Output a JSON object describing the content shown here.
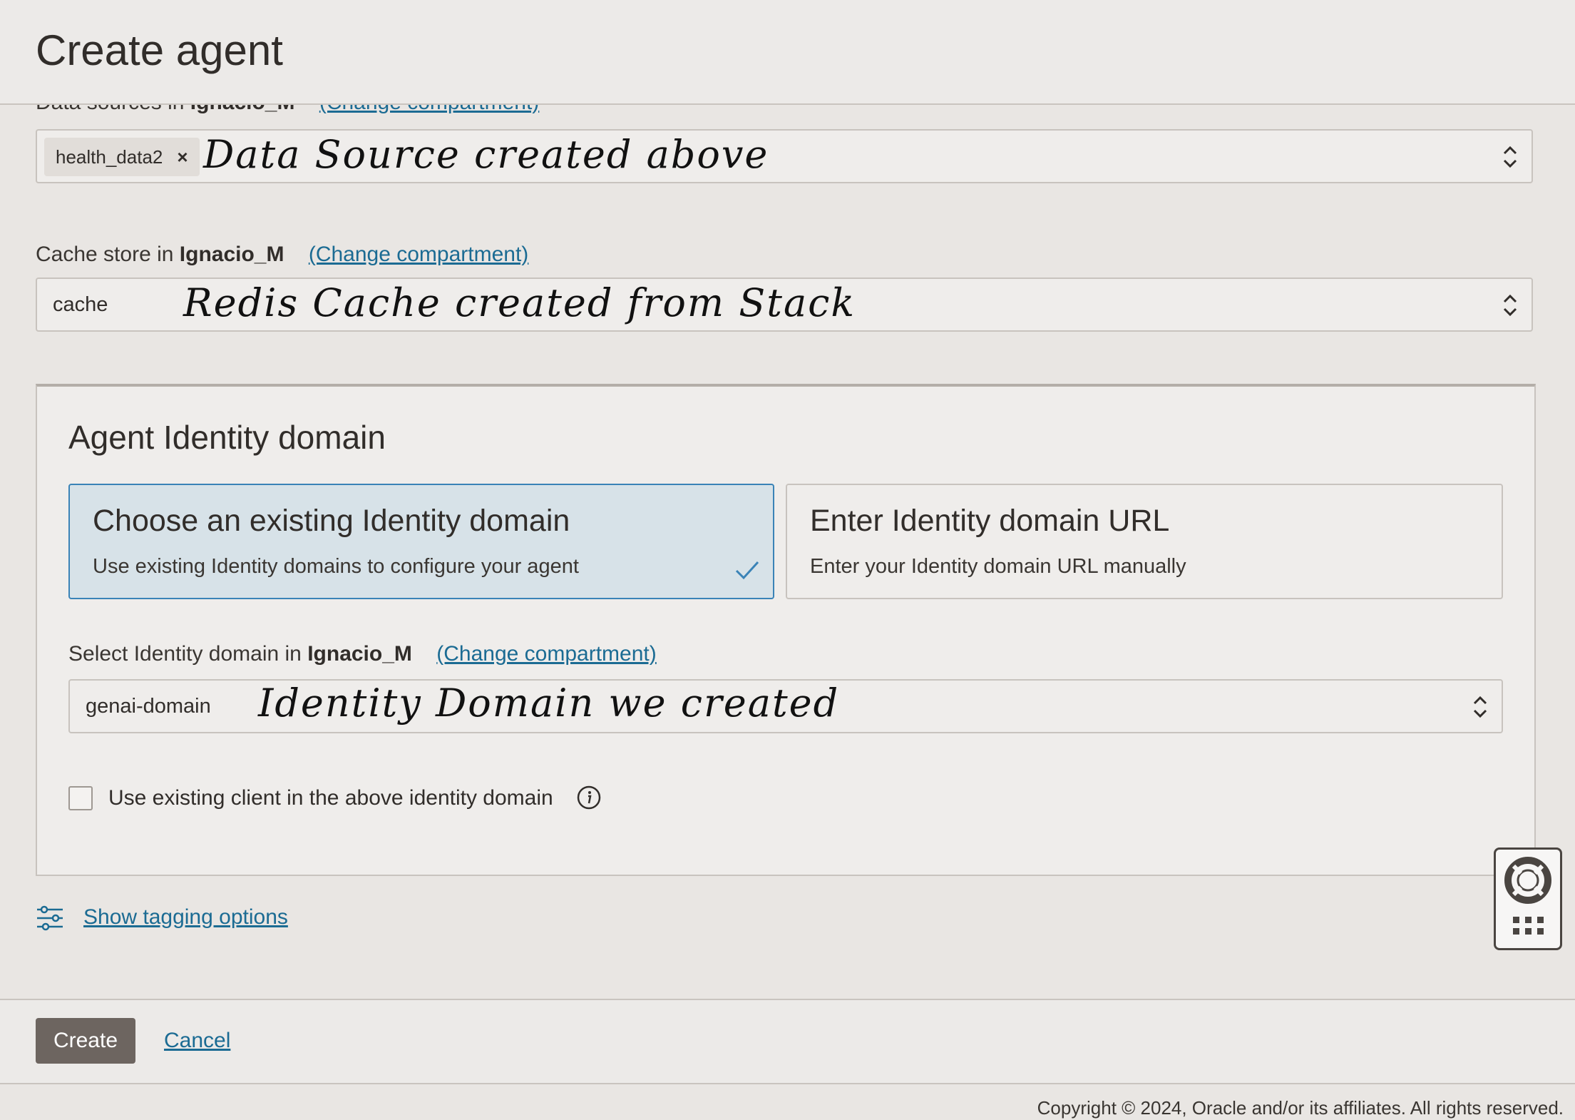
{
  "page": {
    "title": "Create agent"
  },
  "data_sources": {
    "label_prefix": "Data sources in",
    "compartment": "Ignacio_M",
    "change_link": "(Change compartment)",
    "chip_label": "health_data2",
    "chip_remove": "×",
    "annotation": "Data Source created above"
  },
  "cache_store": {
    "label_prefix": "Cache store in",
    "compartment": "Ignacio_M",
    "change_link": "(Change compartment)",
    "value": "cache",
    "annotation": "Redis Cache created from Stack"
  },
  "identity_panel": {
    "title": "Agent Identity domain",
    "options": [
      {
        "title": "Choose an existing Identity domain",
        "desc": "Use existing Identity domains to configure your agent",
        "selected": true
      },
      {
        "title": "Enter Identity domain URL",
        "desc": "Enter your Identity domain URL manually",
        "selected": false
      }
    ],
    "select_label_prefix": "Select Identity domain in",
    "compartment": "Ignacio_M",
    "change_link": "(Change compartment)",
    "value": "genai-domain",
    "annotation": "Identity Domain we created",
    "checkbox_label": "Use existing client in the above identity domain",
    "checkbox_checked": false
  },
  "tagging": {
    "label": "Show tagging options"
  },
  "footer": {
    "create_label": "Create",
    "cancel_label": "Cancel"
  },
  "copyright": "Copyright © 2024, Oracle and/or its affiliates. All rights reserved.",
  "colors": {
    "link": "#1b6b93",
    "selected_border": "#3a83b7",
    "selected_bg": "#d7e2e8",
    "primary_button": "#6d6560"
  },
  "icons": [
    "updown-chevron-icon",
    "checkmark-icon",
    "info-icon",
    "tag-sliders-icon",
    "lifebuoy-icon",
    "grid-dots-icon"
  ]
}
